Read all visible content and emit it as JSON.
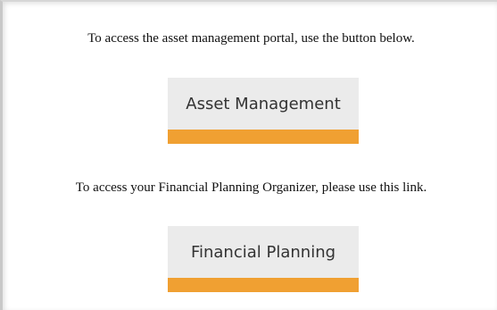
{
  "asset_section": {
    "intro_text": "To access the asset management portal, use the button below.",
    "button_label": "Asset Management"
  },
  "financial_section": {
    "intro_text": "To access your Financial Planning Organizer, please use this link.",
    "button_label": "Financial Planning"
  },
  "colors": {
    "button_face": "#ebebeb",
    "button_accent": "#f0a032",
    "text": "#111111"
  }
}
